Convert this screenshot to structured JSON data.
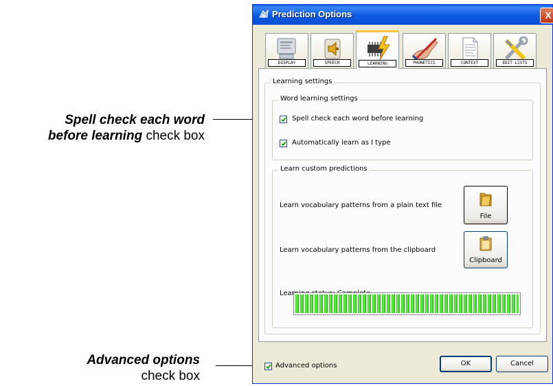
{
  "annotations": {
    "spell_check_bold": "Spell check each word",
    "spell_check_bold2": "before learning",
    "spell_check_tail": " check box",
    "advanced_bold": "Advanced options",
    "advanced_tail": "check box"
  },
  "window": {
    "title": "Prediction Options",
    "close_label": "X"
  },
  "tabs": [
    {
      "label": "DISPLAY",
      "icon": "display-icon"
    },
    {
      "label": "SPEECH",
      "icon": "speaker-icon"
    },
    {
      "label": "LEARNING",
      "icon": "chip-lightning-icon",
      "active": true
    },
    {
      "label": "PHONETICS",
      "icon": "hand-writing-icon"
    },
    {
      "label": "CONTEXT",
      "icon": "document-icon"
    },
    {
      "label": "EDIT LISTS",
      "icon": "tools-icon"
    }
  ],
  "learning": {
    "group_title": "Learning settings",
    "word_group_title": "Word learning settings",
    "spell_check_label": "Spell check each word before learning",
    "spell_check_checked": true,
    "auto_learn_label": "Automatically learn as I type",
    "auto_learn_checked": true,
    "custom_group_title": "Learn custom predictions",
    "file_text": "Learn vocabulary patterns from a plain text file",
    "file_button": "File",
    "clipboard_text": "Learn vocabulary patterns from the clipboard",
    "clipboard_button": "Clipboard",
    "status_text": "Learning status: Complete",
    "progress": 1.0
  },
  "footer": {
    "advanced_label": "Advanced options",
    "advanced_checked": true,
    "ok_label": "OK",
    "cancel_label": "Cancel"
  },
  "colors": {
    "titlebar": "#0a5ee6",
    "progress": "#25d400",
    "tab_highlight": "#ffc83c"
  }
}
